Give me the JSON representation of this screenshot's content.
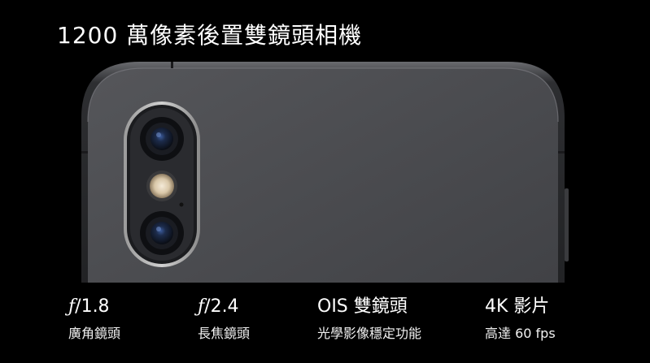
{
  "headline": "1200 萬像素後置雙鏡頭相機",
  "specs": [
    {
      "value_prefix": "ƒ",
      "value": "/1.8",
      "caption": "廣角鏡頭"
    },
    {
      "value_prefix": "ƒ",
      "value": "/2.4",
      "caption": "長焦鏡頭"
    },
    {
      "value_prefix": "",
      "value": "OIS 雙鏡頭",
      "caption": "光學影像穩定功能"
    },
    {
      "value_prefix": "",
      "value": "4K 影片",
      "caption": "高達 60 fps"
    }
  ],
  "colors": {
    "background": "#000000",
    "phone_body": "#4b4c50",
    "phone_frame": "#2a2a2c",
    "text": "#ffffff"
  }
}
